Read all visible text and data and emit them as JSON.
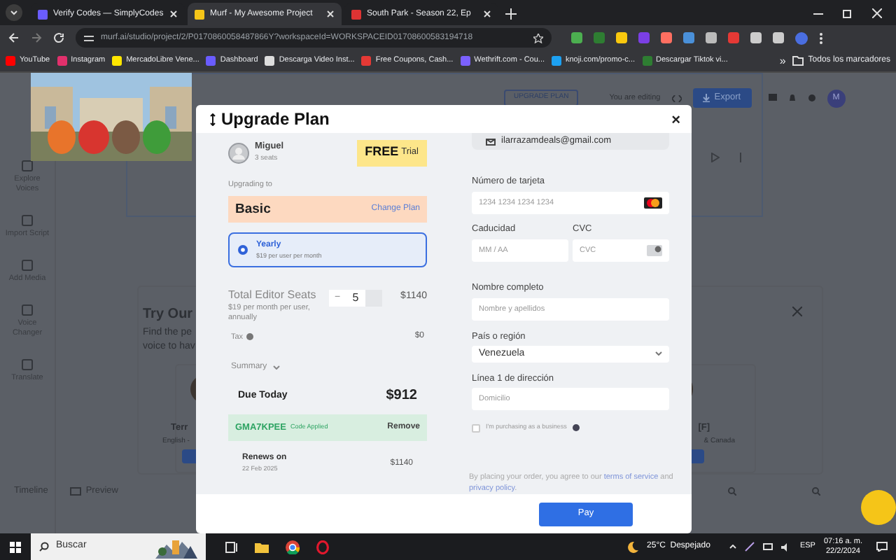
{
  "browser": {
    "tabs": [
      {
        "title": "Verify Codes — SimplyCodes",
        "selected": false
      },
      {
        "title": "Murf - My Awesome Project",
        "selected": true
      },
      {
        "title": "South Park - Season 22, Ep",
        "selected": false
      }
    ],
    "address": "murf.ai/studio/project/2/P0170860058487866Y?workspaceId=WORKSPACEID01708600583194718",
    "bookmarks": [
      "YouTube",
      "Instagram",
      "MercadoLibre Vene...",
      "Dashboard",
      "Descarga Video Inst...",
      "Free Coupons, Cash...",
      "Wethrift.com - Cou...",
      "knoji.com/promo-c...",
      "Descargar Tiktok vi..."
    ],
    "more": "»",
    "all_bookmarks": "Todos los marcadores"
  },
  "app": {
    "upgrade_button": "UPGRADE PLAN",
    "editing": "You are editing",
    "export": "Export",
    "avatar": "M",
    "sidebar": [
      "Explore Voices",
      "Import Script",
      "Add Media",
      "Voice Changer",
      "Translate"
    ],
    "promo_title": "Try Our",
    "promo_lines": [
      "Find the pe",
      "voice to hav"
    ],
    "voice_left": {
      "name": "Terr",
      "lang": "English -"
    },
    "voice_right": {
      "name": "[F]",
      "lang": "& Canada"
    },
    "timeline": "Timeline",
    "preview": "Preview"
  },
  "modal": {
    "title": "Upgrade Plan",
    "user": "Miguel",
    "seats_note": "3 seats",
    "badge_strong": "FREE",
    "badge_rest": "Trial",
    "upgrading_label": "Upgrading to",
    "plan": "Basic",
    "change_plan": "Change Plan",
    "billing": [
      {
        "label": "Yearly",
        "price": "$19 per user per month",
        "selected": true
      }
    ],
    "seats_title": "Total Editor Seats",
    "seats_sub": "$19 per month per user, annually",
    "minus": "−",
    "seat_count": "5",
    "seats_total": "$1140",
    "tax_label": "Tax",
    "tax_value": "$0",
    "summary": "Summary",
    "due_label": "Due Today",
    "due_value": "$912",
    "code": "GMA7KPEE",
    "code_note": "Code Applied",
    "remove": "Remove",
    "renews_label": "Renews on",
    "renews_date": "22 Feb 2025",
    "renews_value": "$1140",
    "email": "ilarrazamdeals@gmail.com",
    "card_label": "Número de tarjeta",
    "card_placeholder": "1234 1234 1234 1234",
    "expiry_label": "Caducidad",
    "expiry_placeholder": "MM / AA",
    "cvc_label": "CVC",
    "cvc_placeholder": "CVC",
    "name_label": "Nombre completo",
    "name_placeholder": "Nombre y apellidos",
    "country_label": "País o región",
    "country_value": "Venezuela",
    "address_label": "Línea 1 de dirección",
    "address_placeholder": "Domicilio",
    "business": {
      "label": "I'm purchasing as a business",
      "checked": false
    },
    "legal": "By placing your order, you agree to our ",
    "terms": "terms of service",
    "legal_and": " and ",
    "privacy": "privacy policy",
    "legal_end": ".",
    "pay": "Pay",
    "close": "×"
  },
  "taskbar": {
    "search": "Buscar",
    "weather": "25°C  Despejado",
    "lang": "ESP",
    "time": "07:16 a. m.",
    "date": "22/2/2024"
  }
}
